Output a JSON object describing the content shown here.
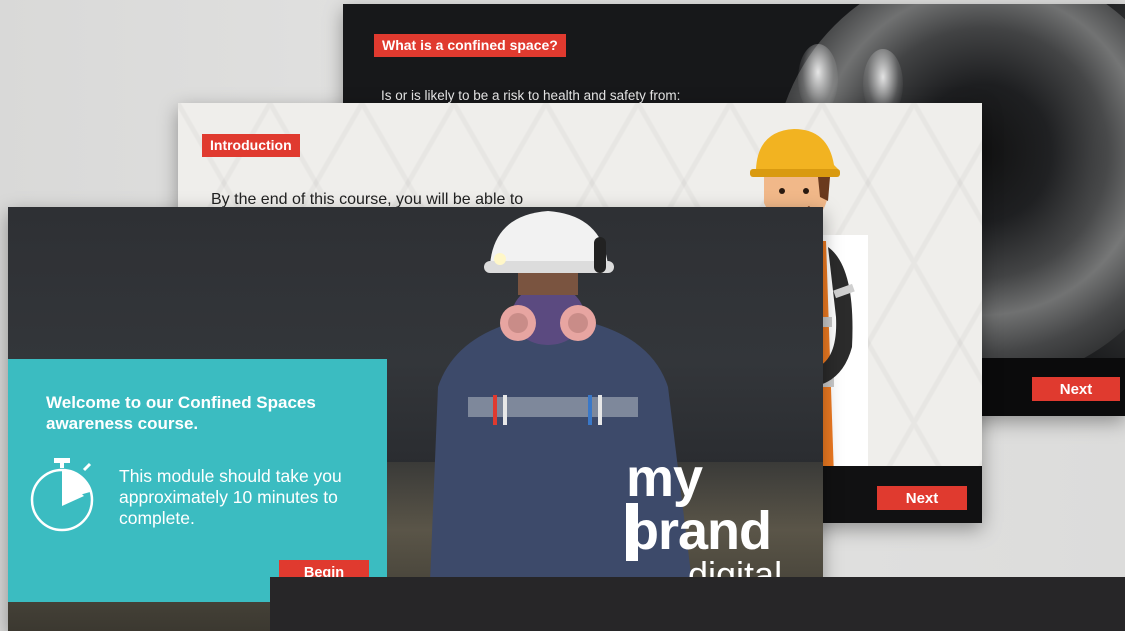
{
  "slides": {
    "back": {
      "tag": "What is a confined space?",
      "body": "Is or is likely to be a risk to health and safety from:",
      "next_label": "Next"
    },
    "middle": {
      "tag": "Introduction",
      "body": "By the end of this course, you will be able to",
      "next_label": "Next"
    },
    "front": {
      "welcome_title": "Welcome to our Confined Spaces awareness course.",
      "welcome_body": "This module should take you approximately 10 minutes to complete.",
      "begin_label": "Begin",
      "brand_line1": "my",
      "brand_line2": "brand",
      "brand_line3": "digital",
      "timer_icon": "stopwatch-play-icon"
    }
  },
  "colors": {
    "accent_red": "#e03a2f",
    "teal_panel": "#3bbcc1",
    "dark_bar": "#111112"
  }
}
